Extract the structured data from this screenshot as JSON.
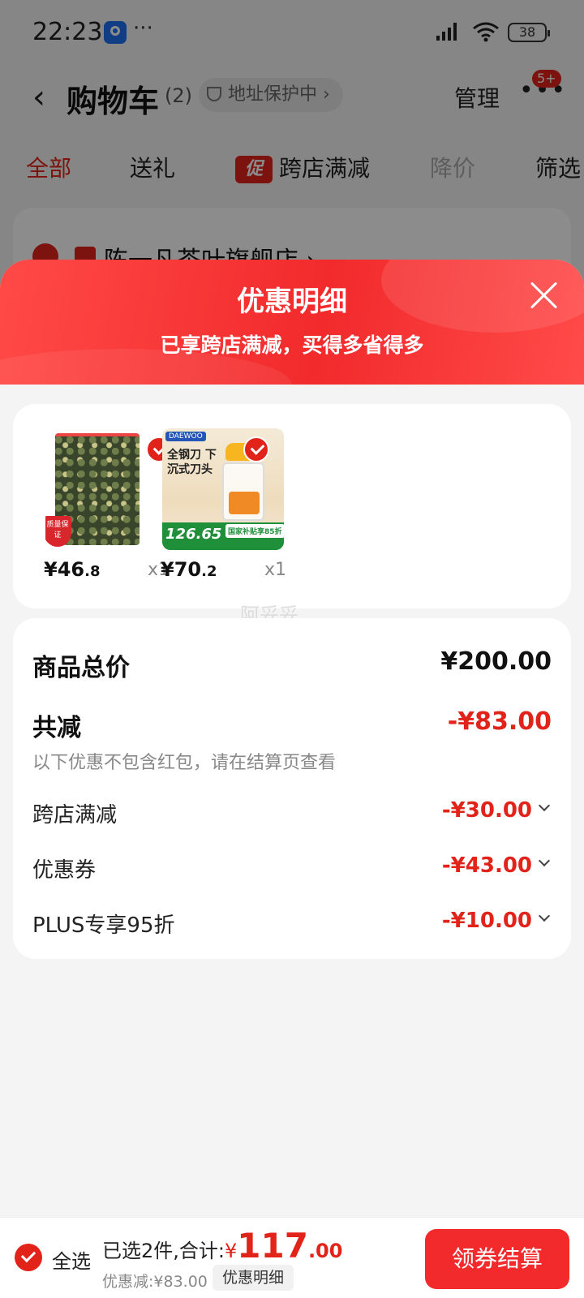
{
  "status_bar": {
    "time": "22:23",
    "dots": "···",
    "battery": "38"
  },
  "header": {
    "back_icon": "chevron-left-icon",
    "title": "购物车",
    "count": "(2)",
    "address_protection": "地址保护中",
    "manage": "管理",
    "more": "•••",
    "message_badge": "5+"
  },
  "tabs": [
    {
      "label": "全部"
    },
    {
      "label": "送礼"
    },
    {
      "label": "跨店满减",
      "tag": "促"
    },
    {
      "label": "降价"
    },
    {
      "label": "筛选"
    }
  ],
  "shop": {
    "name": "陈一凡茶叶旗舰店 ›"
  },
  "sheet": {
    "title": "优惠明细",
    "subtitle": "已享跨店满减，买得多省得多",
    "close_icon": "close-icon"
  },
  "products": [
    {
      "price_int": "¥46",
      "price_dec": ".8",
      "qty": "x1",
      "badge_text": "质量保证",
      "image": "tea-bag-image"
    },
    {
      "price_int": "¥70",
      "price_dec": ".2",
      "qty": "x1",
      "brand": "DAEWOO",
      "promo_title": "全钢刀 下沉式刀头",
      "strip_price": "126.65",
      "strip_subsidy": "国家补贴享85折",
      "image": "food-chopper-image"
    }
  ],
  "watermark": "阿妥妥",
  "summary": {
    "total_label": "商品总价",
    "total_value": "¥200.00",
    "reduce_label": "共减",
    "reduce_value": "-¥83.00",
    "note": "以下优惠不包含红包，请在结算页查看",
    "items": [
      {
        "label": "跨店满减",
        "value": "-¥30.00"
      },
      {
        "label": "优惠券",
        "value": "-¥43.00"
      },
      {
        "label": "PLUS专享95折",
        "value": "-¥10.00"
      }
    ]
  },
  "bottom_bar": {
    "select_all": "全选",
    "selected_text": "已选2件,合计:",
    "currency": "¥",
    "amount_int": "117",
    "amount_dec": ".00",
    "discount_text": "优惠减:¥83.00",
    "detail_label": "优惠明细",
    "checkout_label": "领券结算"
  },
  "colors": {
    "accent": "#e2231a",
    "sheet_header": "#f22a2c",
    "background": "#f4f4f4"
  }
}
